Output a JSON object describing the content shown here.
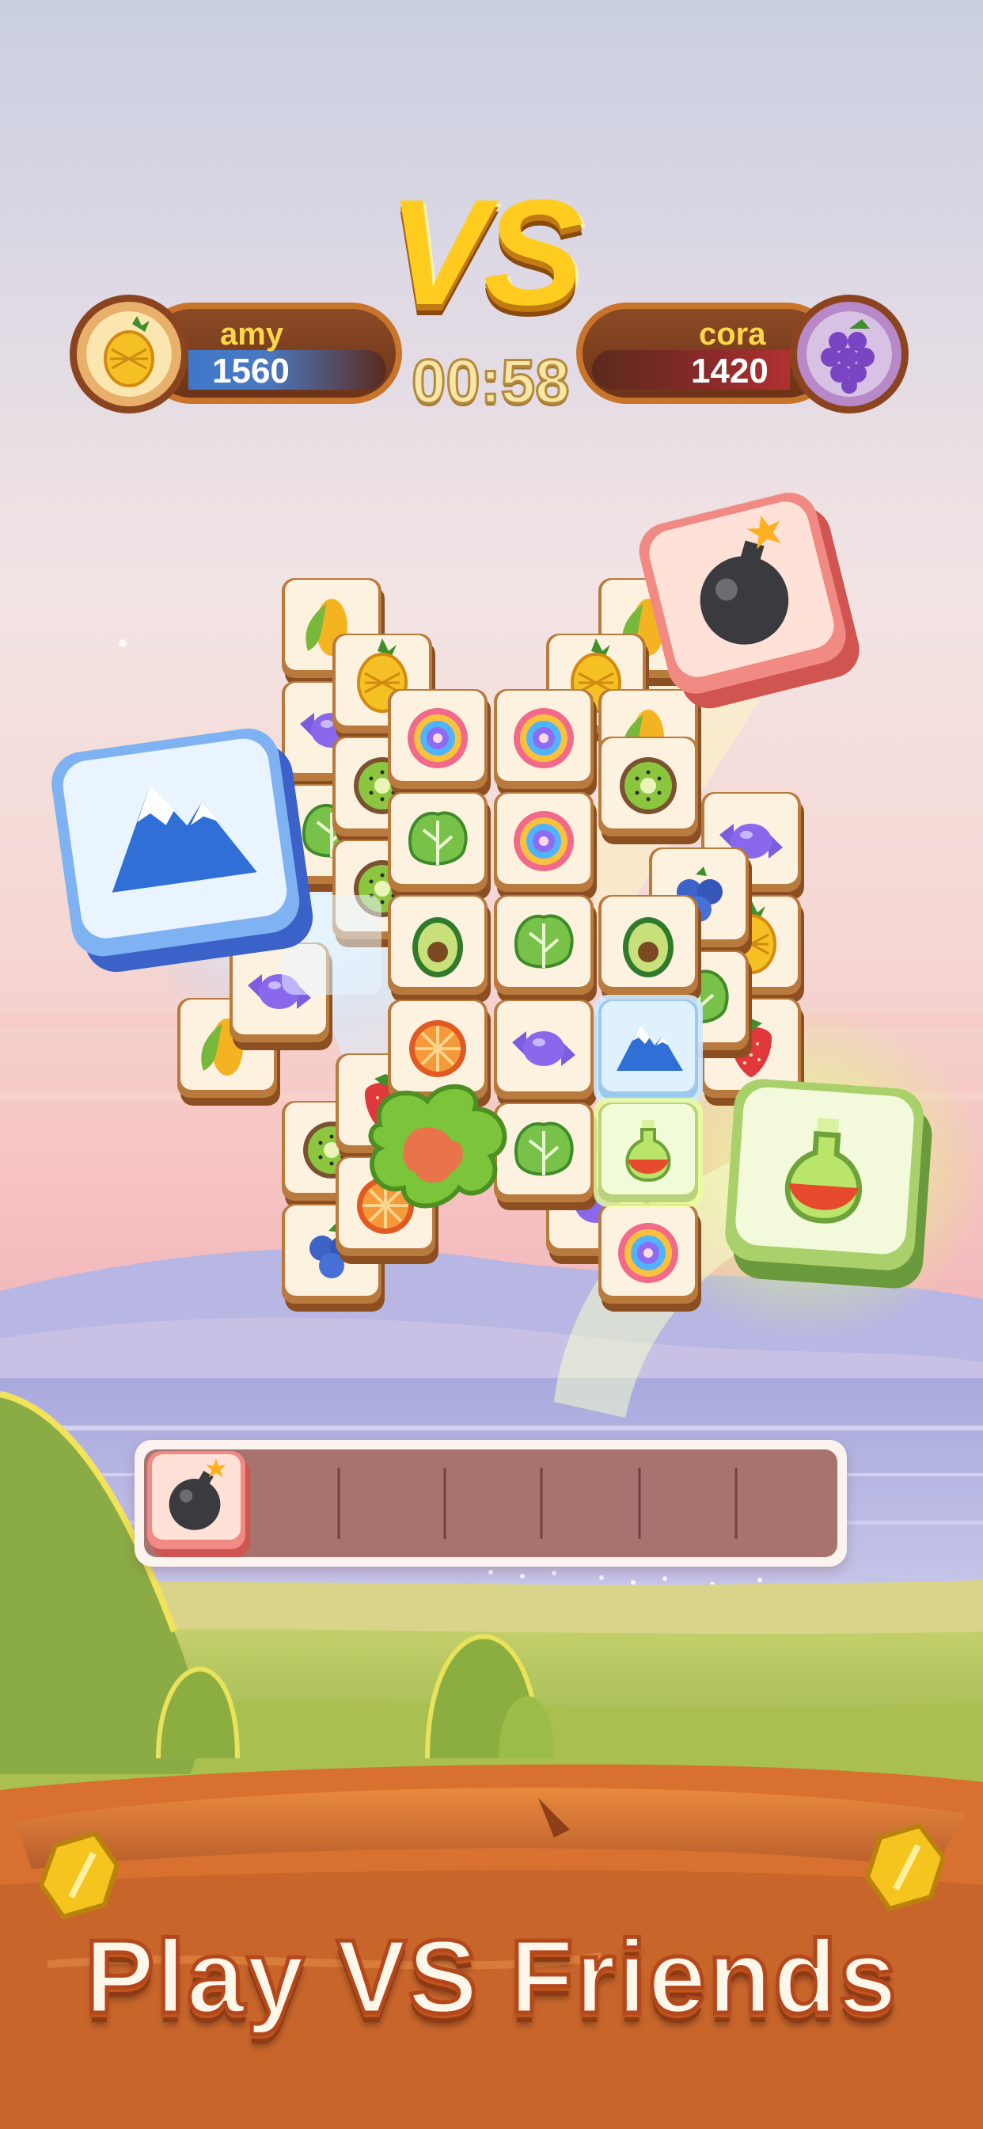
{
  "header": {
    "vs_label": "VS",
    "timer": "00:58"
  },
  "players": [
    {
      "name": "amy",
      "score": "1560",
      "avatar_icon": "pineapple-icon"
    },
    {
      "name": "cora",
      "score": "1420",
      "avatar_icon": "grapes-icon"
    }
  ],
  "board": {
    "flying_tiles": [
      "mountain-icon",
      "bomb-icon",
      "potion-icon"
    ],
    "tile_icons": [
      "corn-icon",
      "pineapple-icon",
      "candy-icon",
      "kiwi-icon",
      "swirl-candy-icon",
      "lettuce-icon",
      "avocado-icon",
      "blueberry-icon",
      "orange-slice-icon",
      "strawberry-icon",
      "mountain-icon",
      "potion-icon",
      "bomb-icon"
    ]
  },
  "tray": {
    "slots": 7,
    "filled": [
      "bomb-icon"
    ]
  },
  "footer": {
    "title": "Play VS Friends"
  },
  "colors": {
    "tile_face": "#fdf1e0",
    "tile_side": "#a9682f",
    "tray_bg": "#a8736f",
    "title_fill": "#fff7ea",
    "title_stroke": "#b4471b",
    "gold": "#ffcc1f"
  }
}
